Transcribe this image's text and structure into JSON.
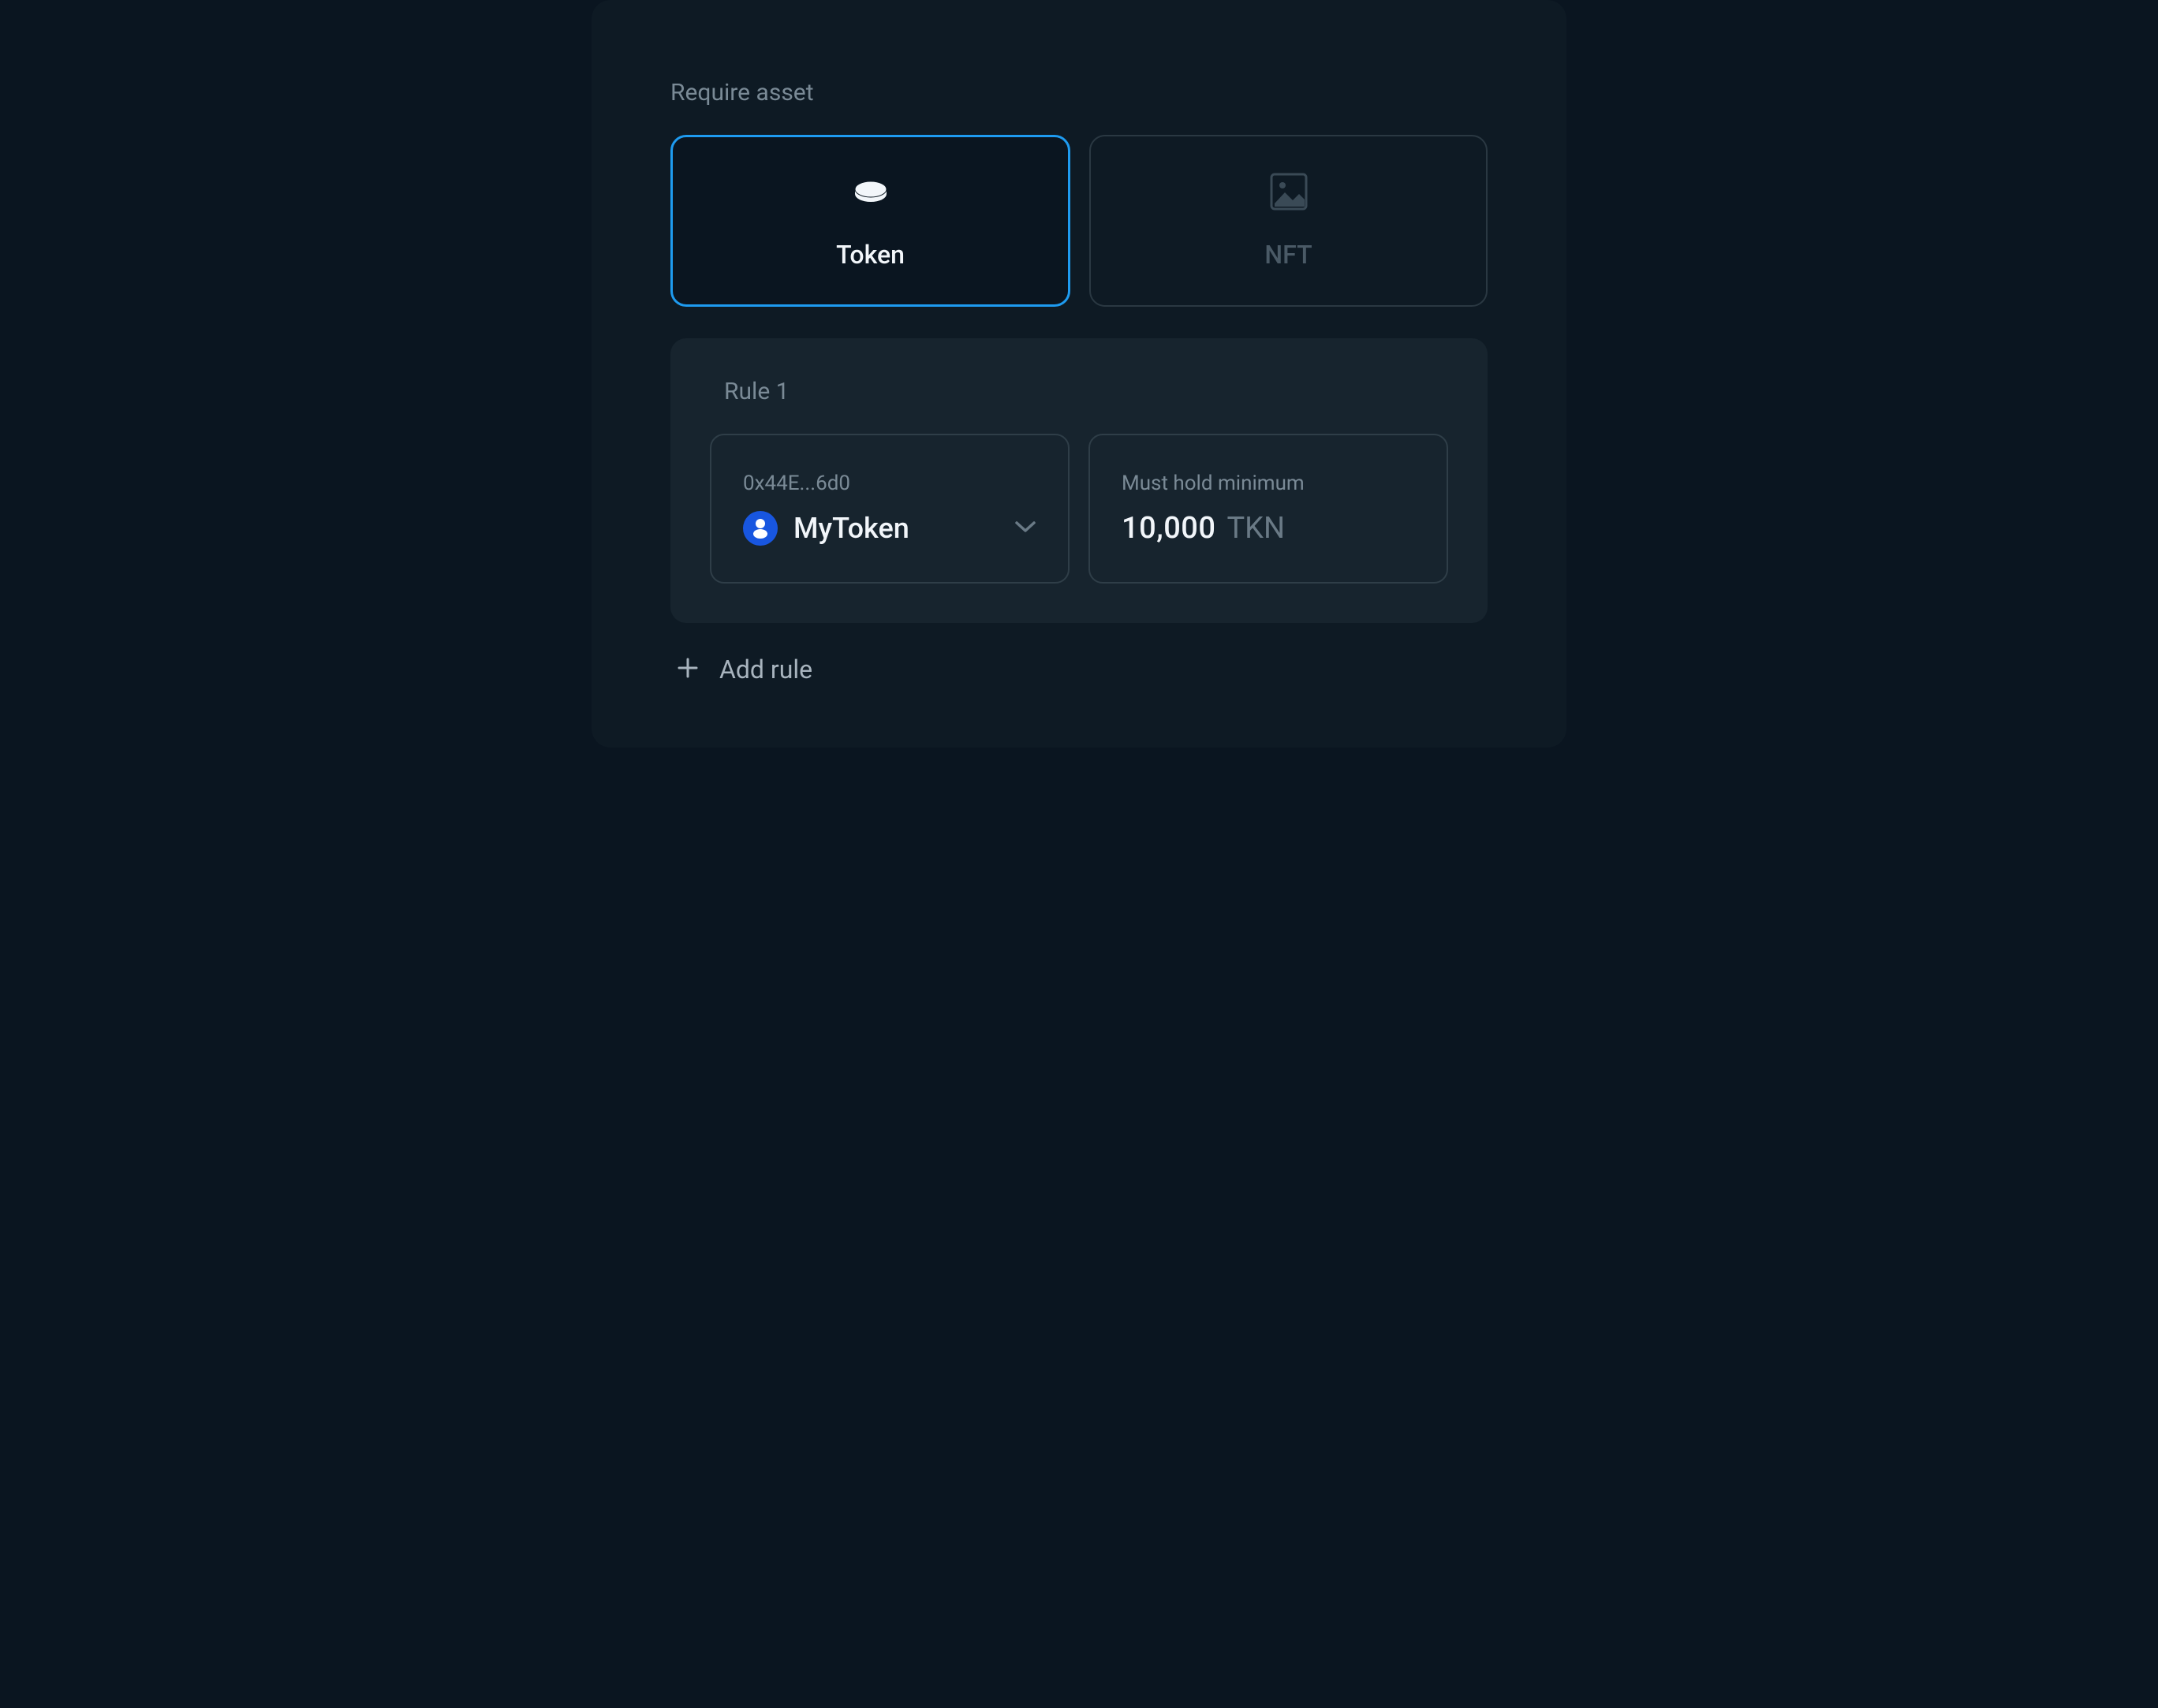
{
  "section_label": "Require asset",
  "asset_types": {
    "token": {
      "label": "Token",
      "selected": true
    },
    "nft": {
      "label": "NFT",
      "selected": false
    }
  },
  "rules": [
    {
      "title": "Rule 1",
      "token": {
        "address_short": "0x44E...6d0",
        "name": "MyToken"
      },
      "minimum": {
        "label": "Must hold minimum",
        "amount": "10,000",
        "unit": "TKN"
      }
    }
  ],
  "add_rule_label": "Add rule"
}
